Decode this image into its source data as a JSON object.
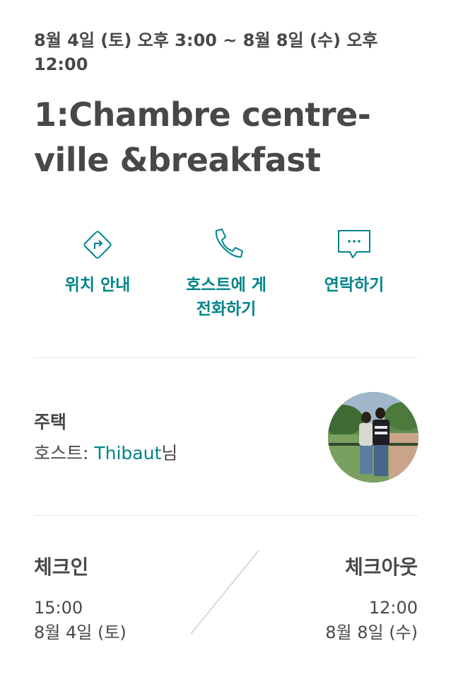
{
  "reservation": {
    "date_range": "8월 4일 (토) 오후 3:00 ~ 8월 8일 (수) 오후 12:00",
    "listing_title": "1:Chambre centre-ville &breakfast"
  },
  "actions": [
    {
      "label": "위치 안내",
      "icon": "directions-icon"
    },
    {
      "label": "호스트에 게 전화하기",
      "icon": "phone-icon"
    },
    {
      "label": "연락하기",
      "icon": "message-icon"
    }
  ],
  "host": {
    "listing_type": "주택",
    "prefix": "호스트: ",
    "name": "Thibaut",
    "suffix": "님"
  },
  "checkin": {
    "label": "체크인",
    "time": "15:00",
    "date": "8월 4일 (토)"
  },
  "checkout": {
    "label": "체크아웃",
    "time": "12:00",
    "date": "8월 8일 (수)"
  },
  "colors": {
    "accent": "#008489",
    "text": "#484848",
    "divider": "#e4e4e4"
  }
}
